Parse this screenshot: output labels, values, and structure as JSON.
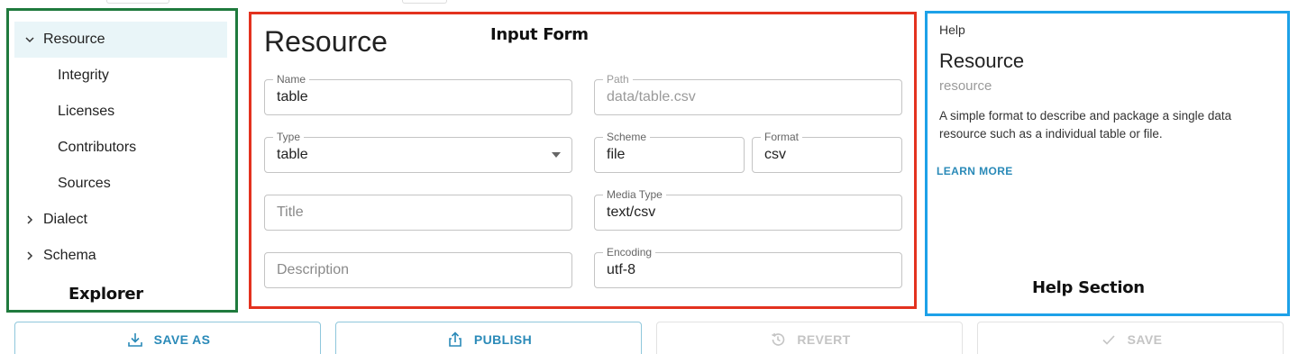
{
  "explorer": {
    "items": [
      {
        "label": "Resource",
        "chevron": "expanded"
      },
      {
        "label": "Integrity",
        "chevron": "none"
      },
      {
        "label": "Licenses",
        "chevron": "none"
      },
      {
        "label": "Contributors",
        "chevron": "none"
      },
      {
        "label": "Sources",
        "chevron": "none"
      },
      {
        "label": "Dialect",
        "chevron": "collapsed"
      },
      {
        "label": "Schema",
        "chevron": "collapsed"
      }
    ],
    "annotation": "Explorer"
  },
  "form": {
    "title": "Resource",
    "annotation": "Input Form",
    "fields": {
      "name": {
        "label": "Name",
        "value": "table"
      },
      "path": {
        "label": "Path",
        "value": "data/table.csv"
      },
      "type": {
        "label": "Type",
        "value": "table"
      },
      "scheme": {
        "label": "Scheme",
        "value": "file"
      },
      "format": {
        "label": "Format",
        "value": "csv"
      },
      "title": {
        "placeholder": "Title"
      },
      "media_type": {
        "label": "Media Type",
        "value": "text/csv"
      },
      "description": {
        "placeholder": "Description"
      },
      "encoding": {
        "label": "Encoding",
        "value": "utf-8"
      }
    }
  },
  "help": {
    "header": "Help",
    "title": "Resource",
    "subtitle": "resource",
    "description": "A simple format to describe and package a single data resource such as a individual table or file.",
    "link": "LEARN MORE",
    "annotation": "Help Section"
  },
  "actions": {
    "save_as": "SAVE AS",
    "publish": "PUBLISH",
    "revert": "REVERT",
    "save": "SAVE"
  },
  "colors": {
    "explorer_border": "#1f7a3d",
    "form_border": "#e3321f",
    "help_border": "#1da1e8",
    "accent": "#2a8ab8",
    "selected_bg": "#e9f5f8"
  }
}
